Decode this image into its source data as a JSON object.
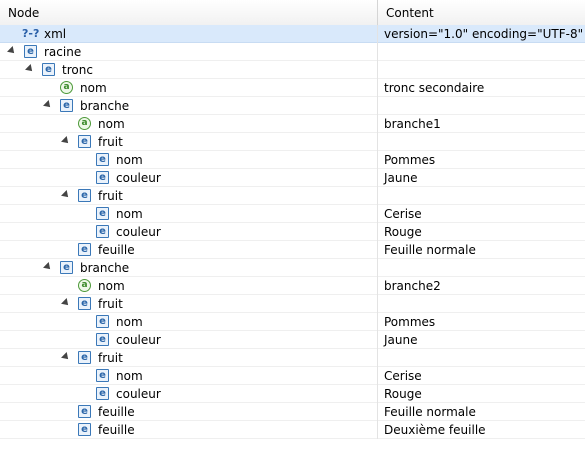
{
  "columns": {
    "node": "Node",
    "content": "Content"
  },
  "rows": [
    {
      "depth": 0,
      "type": "pi",
      "icon": "?-?",
      "name": "xml",
      "content": "version=\"1.0\" encoding=\"UTF-8\"",
      "expanded": false,
      "selected": true
    },
    {
      "depth": 0,
      "type": "elem",
      "icon": "e",
      "name": "racine",
      "content": "",
      "expanded": true
    },
    {
      "depth": 1,
      "type": "elem",
      "icon": "e",
      "name": "tronc",
      "content": "",
      "expanded": true
    },
    {
      "depth": 2,
      "type": "attr",
      "icon": "a",
      "name": "nom",
      "content": "tronc secondaire"
    },
    {
      "depth": 2,
      "type": "elem",
      "icon": "e",
      "name": "branche",
      "content": "",
      "expanded": true
    },
    {
      "depth": 3,
      "type": "attr",
      "icon": "a",
      "name": "nom",
      "content": "branche1"
    },
    {
      "depth": 3,
      "type": "elem",
      "icon": "e",
      "name": "fruit",
      "content": "",
      "expanded": true
    },
    {
      "depth": 4,
      "type": "elem",
      "icon": "e",
      "name": "nom",
      "content": "Pommes"
    },
    {
      "depth": 4,
      "type": "elem",
      "icon": "e",
      "name": "couleur",
      "content": "Jaune"
    },
    {
      "depth": 3,
      "type": "elem",
      "icon": "e",
      "name": "fruit",
      "content": "",
      "expanded": true
    },
    {
      "depth": 4,
      "type": "elem",
      "icon": "e",
      "name": "nom",
      "content": "Cerise"
    },
    {
      "depth": 4,
      "type": "elem",
      "icon": "e",
      "name": "couleur",
      "content": "Rouge"
    },
    {
      "depth": 3,
      "type": "elem",
      "icon": "e",
      "name": "feuille",
      "content": "Feuille normale"
    },
    {
      "depth": 2,
      "type": "elem",
      "icon": "e",
      "name": "branche",
      "content": "",
      "expanded": true
    },
    {
      "depth": 3,
      "type": "attr",
      "icon": "a",
      "name": "nom",
      "content": "branche2"
    },
    {
      "depth": 3,
      "type": "elem",
      "icon": "e",
      "name": "fruit",
      "content": "",
      "expanded": true
    },
    {
      "depth": 4,
      "type": "elem",
      "icon": "e",
      "name": "nom",
      "content": "Pommes"
    },
    {
      "depth": 4,
      "type": "elem",
      "icon": "e",
      "name": "couleur",
      "content": "Jaune"
    },
    {
      "depth": 3,
      "type": "elem",
      "icon": "e",
      "name": "fruit",
      "content": "",
      "expanded": true
    },
    {
      "depth": 4,
      "type": "elem",
      "icon": "e",
      "name": "nom",
      "content": "Cerise"
    },
    {
      "depth": 4,
      "type": "elem",
      "icon": "e",
      "name": "couleur",
      "content": "Rouge"
    },
    {
      "depth": 3,
      "type": "elem",
      "icon": "e",
      "name": "feuille",
      "content": "Feuille normale"
    },
    {
      "depth": 3,
      "type": "elem",
      "icon": "e",
      "name": "feuille",
      "content": "Deuxième feuille"
    }
  ],
  "colors": {
    "selection": "#d9e9fb",
    "element_icon": "#3b78b8",
    "attribute_icon": "#4e9a3a"
  }
}
